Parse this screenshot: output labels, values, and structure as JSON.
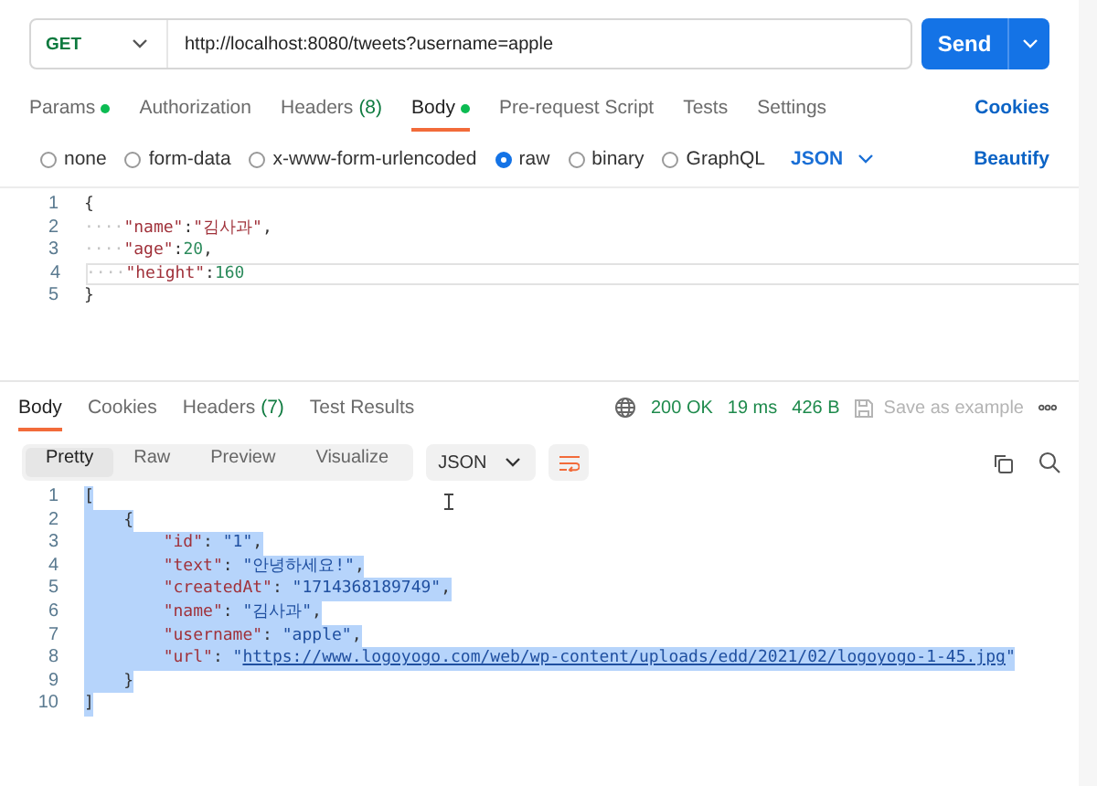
{
  "request": {
    "method": "GET",
    "url": "http://localhost:8080/tweets?username=apple",
    "send": "Send"
  },
  "request_tabs": [
    {
      "label": "Params",
      "dot": true,
      "selected": false
    },
    {
      "label": "Authorization",
      "dot": false,
      "selected": false
    },
    {
      "label": "Headers",
      "count": "(8)",
      "dot": false,
      "selected": false
    },
    {
      "label": "Body",
      "dot": true,
      "selected": true
    },
    {
      "label": "Pre-request Script",
      "dot": false,
      "selected": false
    },
    {
      "label": "Tests",
      "dot": false,
      "selected": false
    },
    {
      "label": "Settings",
      "dot": false,
      "selected": false
    }
  ],
  "cookies_link": "Cookies",
  "body_types": [
    {
      "label": "none",
      "selected": false
    },
    {
      "label": "form-data",
      "selected": false
    },
    {
      "label": "x-www-form-urlencoded",
      "selected": false
    },
    {
      "label": "raw",
      "selected": true
    },
    {
      "label": "binary",
      "selected": false
    },
    {
      "label": "GraphQL",
      "selected": false
    }
  ],
  "body_format": "JSON",
  "beautify": "Beautify",
  "request_body": [
    {
      "number": "1",
      "active": false,
      "tokens": [
        {
          "punct": "{"
        }
      ]
    },
    {
      "number": "2",
      "active": false,
      "tokens": [
        {
          "ws": "····"
        },
        {
          "key": "\"name\""
        },
        {
          "punct": ":"
        },
        {
          "key": "\"김사과\""
        },
        {
          "punct": ","
        }
      ]
    },
    {
      "number": "3",
      "active": false,
      "tokens": [
        {
          "ws": "····"
        },
        {
          "key": "\"age\""
        },
        {
          "punct": ":"
        },
        {
          "number": "20"
        },
        {
          "punct": ","
        }
      ]
    },
    {
      "number": "4",
      "active": true,
      "tokens": [
        {
          "ws": "····"
        },
        {
          "key": "\"height\""
        },
        {
          "punct": ":"
        },
        {
          "number": "160"
        }
      ]
    },
    {
      "number": "5",
      "active": false,
      "tokens": [
        {
          "punct": "}"
        }
      ]
    }
  ],
  "response": {
    "tabs": [
      {
        "label": "Body",
        "selected": true
      },
      {
        "label": "Cookies",
        "selected": false
      },
      {
        "label": "Headers",
        "count": "(7)",
        "selected": false
      },
      {
        "label": "Test Results",
        "selected": false
      }
    ],
    "status": "200 OK",
    "time": "19 ms",
    "size": "426 B",
    "save": "Save as example",
    "view_modes": [
      {
        "label": "Pretty",
        "selected": true
      },
      {
        "label": "Raw",
        "selected": false
      },
      {
        "label": "Preview",
        "selected": false
      },
      {
        "label": "Visualize",
        "selected": false
      }
    ],
    "format": "JSON",
    "lines": [
      {
        "number": "1",
        "selected": true,
        "tokens": [
          {
            "punct": "["
          }
        ]
      },
      {
        "number": "2",
        "selected": true,
        "tokens": [
          {
            "punct": "    {"
          }
        ]
      },
      {
        "number": "3",
        "selected": true,
        "tokens": [
          {
            "key": "        \"id\""
          },
          {
            "punct": ": "
          },
          {
            "string": "\"1\""
          },
          {
            "punct": ","
          }
        ]
      },
      {
        "number": "4",
        "selected": true,
        "tokens": [
          {
            "key": "        \"text\""
          },
          {
            "punct": ": "
          },
          {
            "string": "\"안녕하세요!\""
          },
          {
            "punct": ","
          }
        ]
      },
      {
        "number": "5",
        "selected": true,
        "tokens": [
          {
            "key": "        \"createdAt\""
          },
          {
            "punct": ": "
          },
          {
            "string": "\"1714368189749\""
          },
          {
            "punct": ","
          }
        ]
      },
      {
        "number": "6",
        "selected": true,
        "tokens": [
          {
            "key": "        \"name\""
          },
          {
            "punct": ": "
          },
          {
            "string": "\"김사과\""
          },
          {
            "punct": ","
          }
        ]
      },
      {
        "number": "7",
        "selected": true,
        "tokens": [
          {
            "key": "        \"username\""
          },
          {
            "punct": ": "
          },
          {
            "string": "\"apple\""
          },
          {
            "punct": ","
          }
        ]
      },
      {
        "number": "8",
        "selected": true,
        "tokens": [
          {
            "key": "        \"url\""
          },
          {
            "punct": ": "
          },
          {
            "string": "\""
          },
          {
            "link": "https://www.logoyogo.com/web/wp-content/uploads/edd/2021/02/logoyogo-1-45.jpg"
          },
          {
            "string": "\""
          }
        ]
      },
      {
        "number": "9",
        "selected": true,
        "tokens": [
          {
            "punct": "    }"
          }
        ]
      },
      {
        "number": "10",
        "selected": true,
        "tokens": [
          {
            "punct": "]"
          }
        ]
      }
    ]
  }
}
